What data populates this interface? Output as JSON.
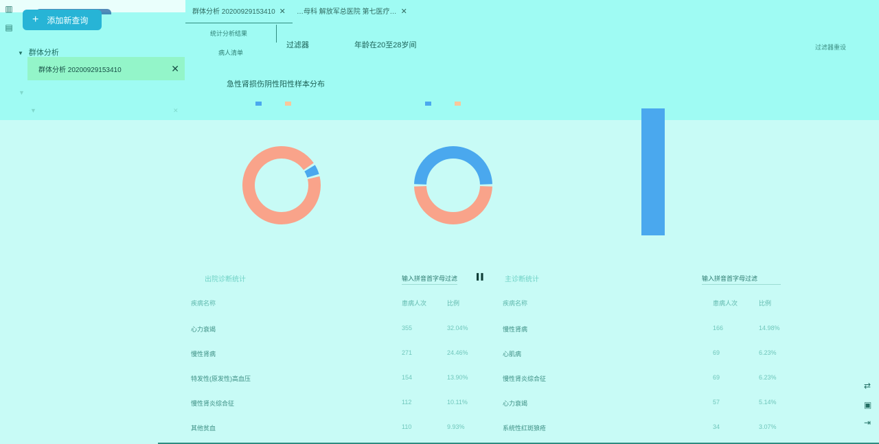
{
  "header": {
    "add_query": "添加新查询"
  },
  "tree": {
    "group1": "群体分析",
    "active_item": "群体分析 20200929153410"
  },
  "tabs": [
    {
      "label": "群体分析 20200929153410"
    },
    {
      "label": "…母科 解放军总医院 第七医疗…"
    }
  ],
  "subtabs": {
    "stats": "统计分析结果",
    "patients": "病人清单"
  },
  "filter": {
    "label": "过滤器",
    "value": "年龄在20至28岁间",
    "reset": "过滤器重设"
  },
  "charts": {
    "donut1_title": "急性肾损伤阴性阳性样本分布"
  },
  "chart_data": [
    {
      "type": "pie",
      "title": "急性肾损伤阴性阳性样本分布",
      "values": [
        95,
        5
      ],
      "colors": [
        "#f9a38a",
        "#4aa8ee"
      ]
    },
    {
      "type": "pie",
      "title": "",
      "values": [
        50,
        50
      ],
      "colors": [
        "#f9a38a",
        "#4aa8ee"
      ]
    },
    {
      "type": "bar",
      "title": "",
      "values": [
        1
      ],
      "colors": [
        "#4aa8ee"
      ]
    }
  ],
  "tables": {
    "left": {
      "title": "出院诊断统计",
      "search_placeholder": "输入拼音首字母过滤",
      "headers": [
        "疾病名称",
        "患病人次",
        "比例"
      ],
      "rows": [
        {
          "name": "心力衰竭",
          "count": "355",
          "ratio": "32.04%"
        },
        {
          "name": "慢性肾病",
          "count": "271",
          "ratio": "24.46%"
        },
        {
          "name": "特发性(原发性)高血压",
          "count": "154",
          "ratio": "13.90%"
        },
        {
          "name": "慢性肾炎综合征",
          "count": "112",
          "ratio": "10.11%"
        },
        {
          "name": "其他贫血",
          "count": "110",
          "ratio": "9.93%"
        }
      ]
    },
    "right": {
      "title": "主诊断统计",
      "search_placeholder": "输入拼音首字母过滤",
      "headers": [
        "疾病名称",
        "患病人次",
        "比例"
      ],
      "rows": [
        {
          "name": "慢性肾病",
          "count": "166",
          "ratio": "14.98%"
        },
        {
          "name": "心肌病",
          "count": "69",
          "ratio": "6.23%"
        },
        {
          "name": "慢性肾炎综合征",
          "count": "69",
          "ratio": "6.23%"
        },
        {
          "name": "心力衰竭",
          "count": "57",
          "ratio": "5.14%"
        },
        {
          "name": "系统性红斑狼疮",
          "count": "34",
          "ratio": "3.07%"
        }
      ]
    }
  },
  "colors": {
    "accent": "#27b4d6",
    "positive": "#f9a38a",
    "negative": "#4aa8ee",
    "active_item": "#93f5c9"
  }
}
